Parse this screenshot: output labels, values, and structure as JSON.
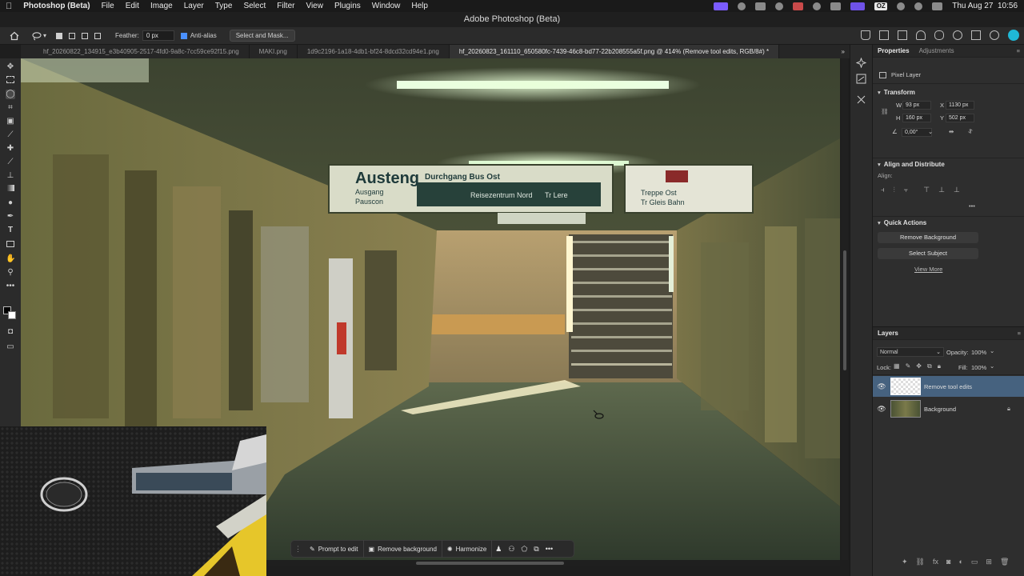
{
  "menubar": {
    "apple": "",
    "app_name": "Photoshop (Beta)",
    "menus": [
      "File",
      "Edit",
      "Image",
      "Layer",
      "Type",
      "Select",
      "Filter",
      "View",
      "Plugins",
      "Window",
      "Help"
    ],
    "oz_label": "OZ",
    "clock": "Thu Aug 27  10:56"
  },
  "titlebar": {
    "title": "Adobe Photoshop (Beta)"
  },
  "options": {
    "feather_label": "Feather:",
    "feather_value": "0 px",
    "antialias_label": "Anti-alias",
    "select_mask_label": "Select and Mask..."
  },
  "tabs": [
    {
      "label": "hf_20260822_134915_e3b40905-2517-4fd0-9a8c-7cc59ce92f15.png"
    },
    {
      "label": "MAKI.png"
    },
    {
      "label": "1d9c2196-1a18-4db1-bf24-8dcd32cd94e1.png"
    },
    {
      "label": "hf_20260823_161110_650580fc-7439-46c8-bd77-22b208555a5f.png @ 414% (Remove tool edits, RGB/8#) *"
    }
  ],
  "tabs_overflow": "»",
  "canvas": {
    "sign_left_title": "Austeng",
    "sign_left_sub": "Durchgang Bus Ost",
    "sign_left_line1": "Ausgang",
    "sign_left_line2": "Pauscon",
    "sign_mid_line": "Reisezentrum Nord",
    "sign_mid_right": "Tr Lere",
    "sign_right_line1": "Treppe Ost",
    "sign_right_line2": "Tr Gleis Bahn"
  },
  "properties": {
    "tab_properties": "Properties",
    "tab_adjustments": "Adjustments",
    "layer_type": "Pixel Layer",
    "transform_title": "Transform",
    "w_label": "W",
    "w_value": "93 px",
    "x_label": "X",
    "x_value": "1130 px",
    "h_label": "H",
    "h_value": "160 px",
    "y_label": "Y",
    "y_value": "502 px",
    "angle_value": "0,00°",
    "align_title": "Align and Distribute",
    "align_label": "Align:",
    "align_more": "•••",
    "quick_actions_title": "Quick Actions",
    "remove_bg_label": "Remove Background",
    "select_subject_label": "Select Subject",
    "view_more_label": "View More"
  },
  "layers": {
    "title": "Layers",
    "blend_mode": "Normal",
    "opacity_label": "Opacity:",
    "opacity_value": "100%",
    "lock_label": "Lock:",
    "fill_label": "Fill:",
    "fill_value": "100%",
    "items": [
      {
        "name": "Remove tool edits",
        "selected": true
      },
      {
        "name": "Background",
        "selected": false
      }
    ]
  },
  "contextbar": {
    "prompt_label": "Prompt to edit",
    "remove_bg_label": "Remove background",
    "harmonize_label": "Harmonize"
  },
  "colors": {
    "selection_blue": "#46627f",
    "accent_purple": "#7b5cff"
  }
}
